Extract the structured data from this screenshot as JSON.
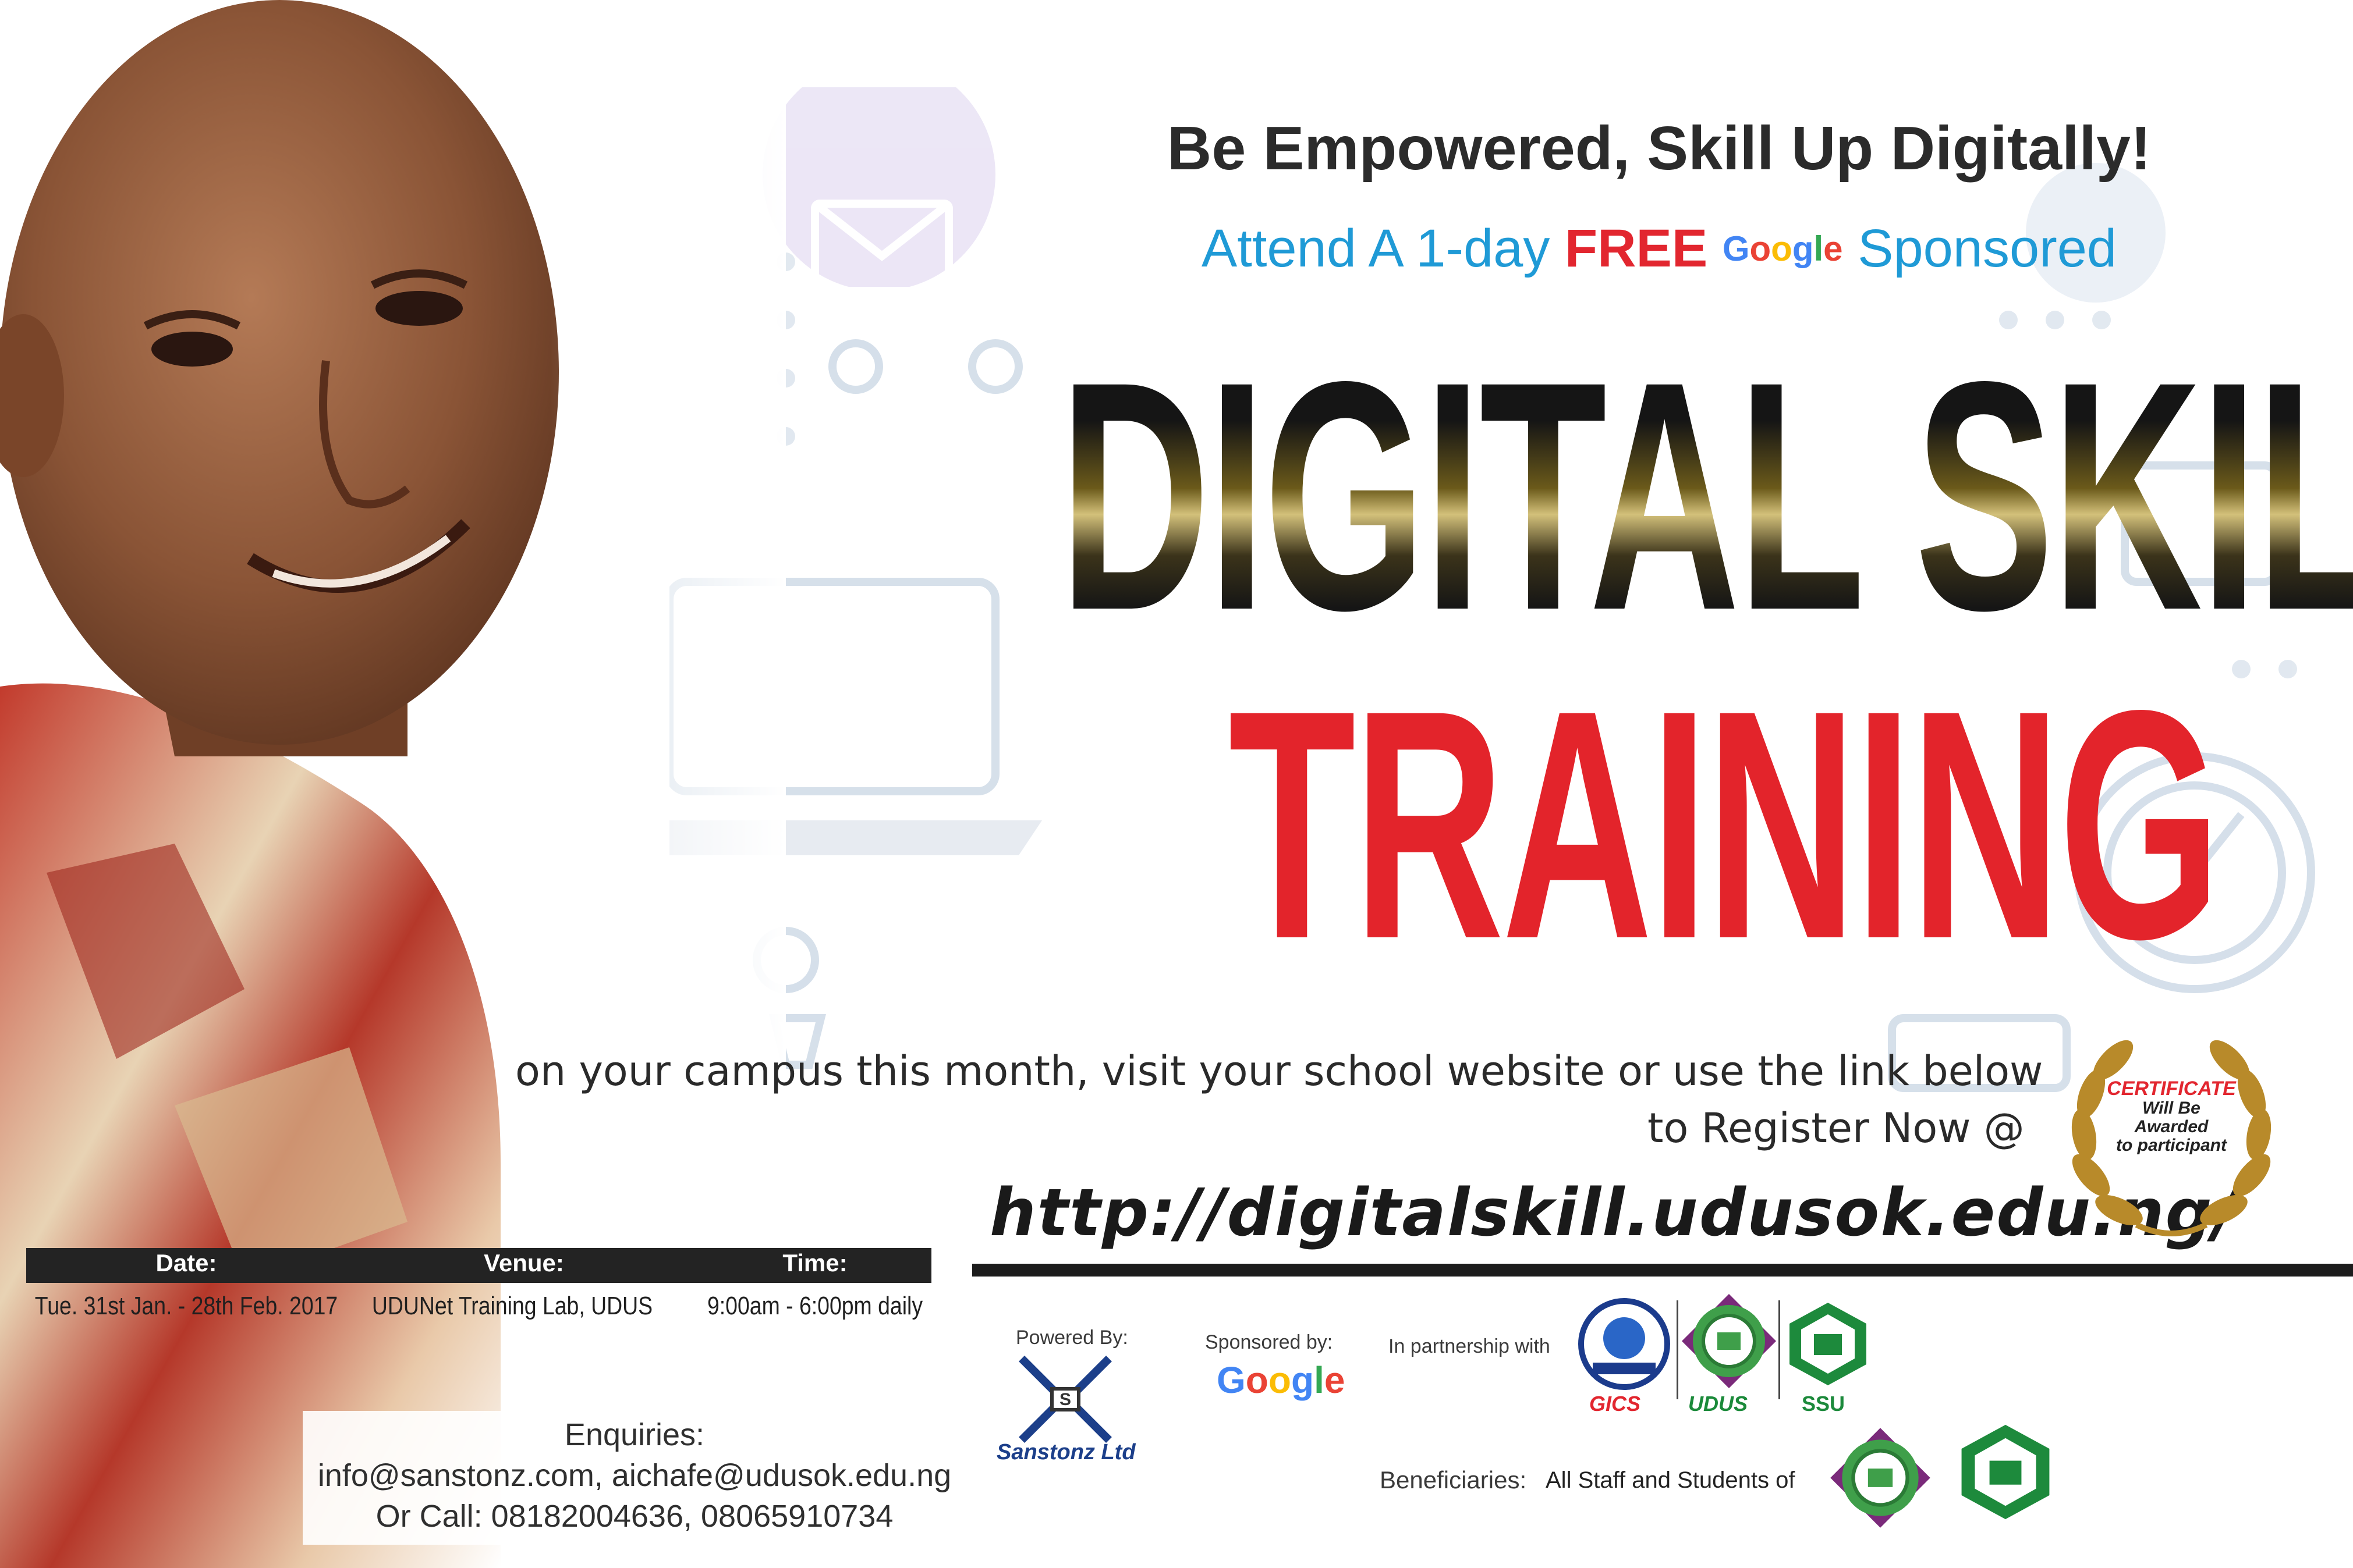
{
  "headline": "Be Empowered, Skill Up Digitally!",
  "subline": {
    "attend": "Attend A 1-day",
    "free": "FREE",
    "google": [
      "G",
      "o",
      "o",
      "g",
      "l",
      "e"
    ],
    "sponsored": "Sponsored"
  },
  "title": {
    "line1": "DIGITAL SKILL",
    "line2": "TRAINING"
  },
  "campus_text": "on your campus this month, visit your school website or use the link below",
  "register_text": "to Register Now @",
  "url": "http://digitalskill.udusok.edu.ng/",
  "certificate": {
    "line1": "CERTIFICATE",
    "line2": "Will Be",
    "line3": "Awarded",
    "line4": "to participant"
  },
  "info": {
    "headers": [
      "Date:",
      "Venue:",
      "Time:"
    ],
    "values": [
      "Tue. 31st Jan. - 28th Feb. 2017",
      "UDUNet Training Lab, UDUS",
      "9:00am - 6:00pm daily"
    ]
  },
  "enquiries": {
    "title": "Enquiries:",
    "emails": "info@sanstonz.com, aichafe@udusok.edu.ng",
    "phones": "Or Call: 08182004636, 08065910734"
  },
  "footer": {
    "powered_by": "Powered By:",
    "powered_company": "Sanstonz Ltd",
    "sponsored_by": "Sponsored by:",
    "partnership": "In partnership with",
    "partners": [
      "GICS",
      "UDUS",
      "SSU"
    ],
    "beneficiaries_label": "Beneficiaries:",
    "beneficiaries_text": "All Staff and Students of"
  },
  "colors": {
    "accent_red": "#e2262f",
    "accent_blue": "#1f9ad6",
    "dark": "#1c1c1c",
    "gold": "#b88a2a"
  }
}
